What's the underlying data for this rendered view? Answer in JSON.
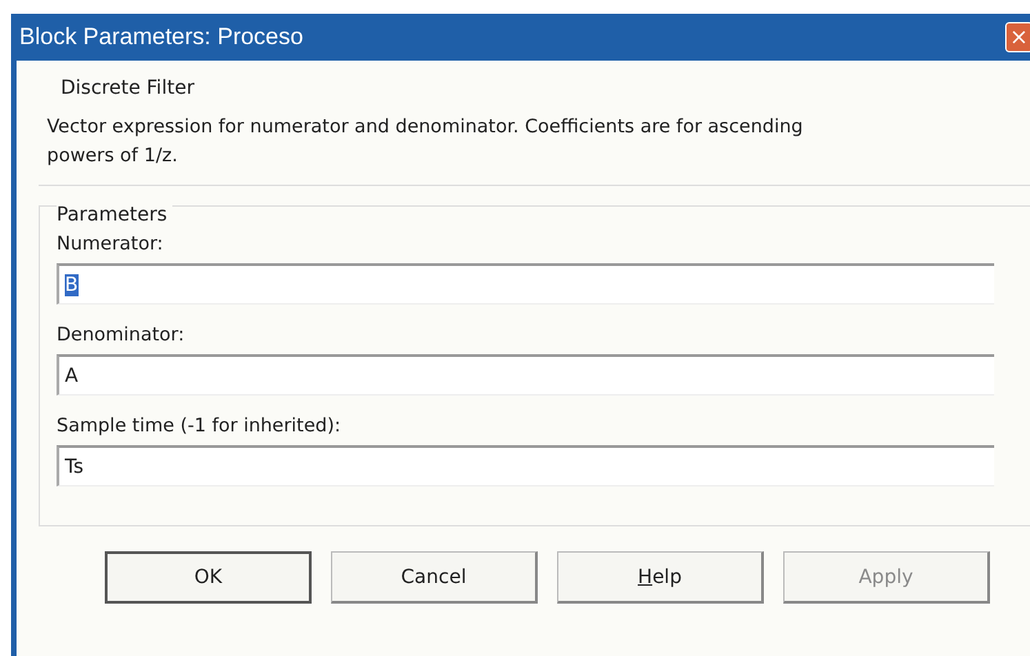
{
  "window": {
    "title": "Block Parameters: Proceso",
    "close": "×"
  },
  "block": {
    "name": "Discrete Filter",
    "description": "Vector expression for numerator and denominator.  Coefficients are for ascending powers of 1/z."
  },
  "parameters": {
    "title": "Parameters",
    "fields": [
      {
        "label": "Numerator:",
        "value": "B",
        "selected": true
      },
      {
        "label": "Denominator:",
        "value": "A",
        "selected": false
      },
      {
        "label": "Sample time (-1 for inherited):",
        "value": "Ts",
        "selected": false
      }
    ]
  },
  "buttons": [
    {
      "label": "OK",
      "default": true,
      "disabled": false,
      "mnemonic": false
    },
    {
      "label": "Cancel",
      "default": false,
      "disabled": false,
      "mnemonic": false
    },
    {
      "label": "Help",
      "default": false,
      "disabled": false,
      "mnemonic": true
    },
    {
      "label": "Apply",
      "default": false,
      "disabled": true,
      "mnemonic": false
    }
  ]
}
